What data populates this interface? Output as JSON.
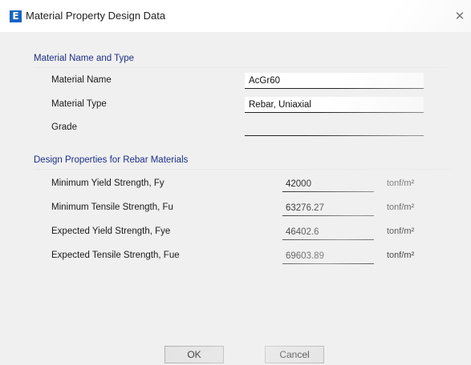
{
  "window": {
    "title": "Material Property Design Data",
    "app_icon_letter": "E",
    "close_glyph": "✕"
  },
  "material_section": {
    "header": "Material Name and Type",
    "rows": [
      {
        "label": "Material Name",
        "value": "AcGr60"
      },
      {
        "label": "Material Type",
        "value": "Rebar, Uniaxial"
      },
      {
        "label": "Grade",
        "value": ""
      }
    ]
  },
  "design_section": {
    "header": "Design Properties for Rebar Materials",
    "rows": [
      {
        "label": "Minimum Yield Strength, Fy",
        "value": "42000",
        "unit": "tonf/m²"
      },
      {
        "label": "Minimum Tensile Strength, Fu",
        "value": "63276.27",
        "unit": "tonf/m²"
      },
      {
        "label": "Expected Yield Strength, Fye",
        "value": "46402.6",
        "unit": "tonf/m²"
      },
      {
        "label": "Expected Tensile Strength, Fue",
        "value": "69603.89",
        "unit": "tonf/m²"
      }
    ]
  },
  "buttons": {
    "ok": "OK",
    "cancel": "Cancel"
  }
}
